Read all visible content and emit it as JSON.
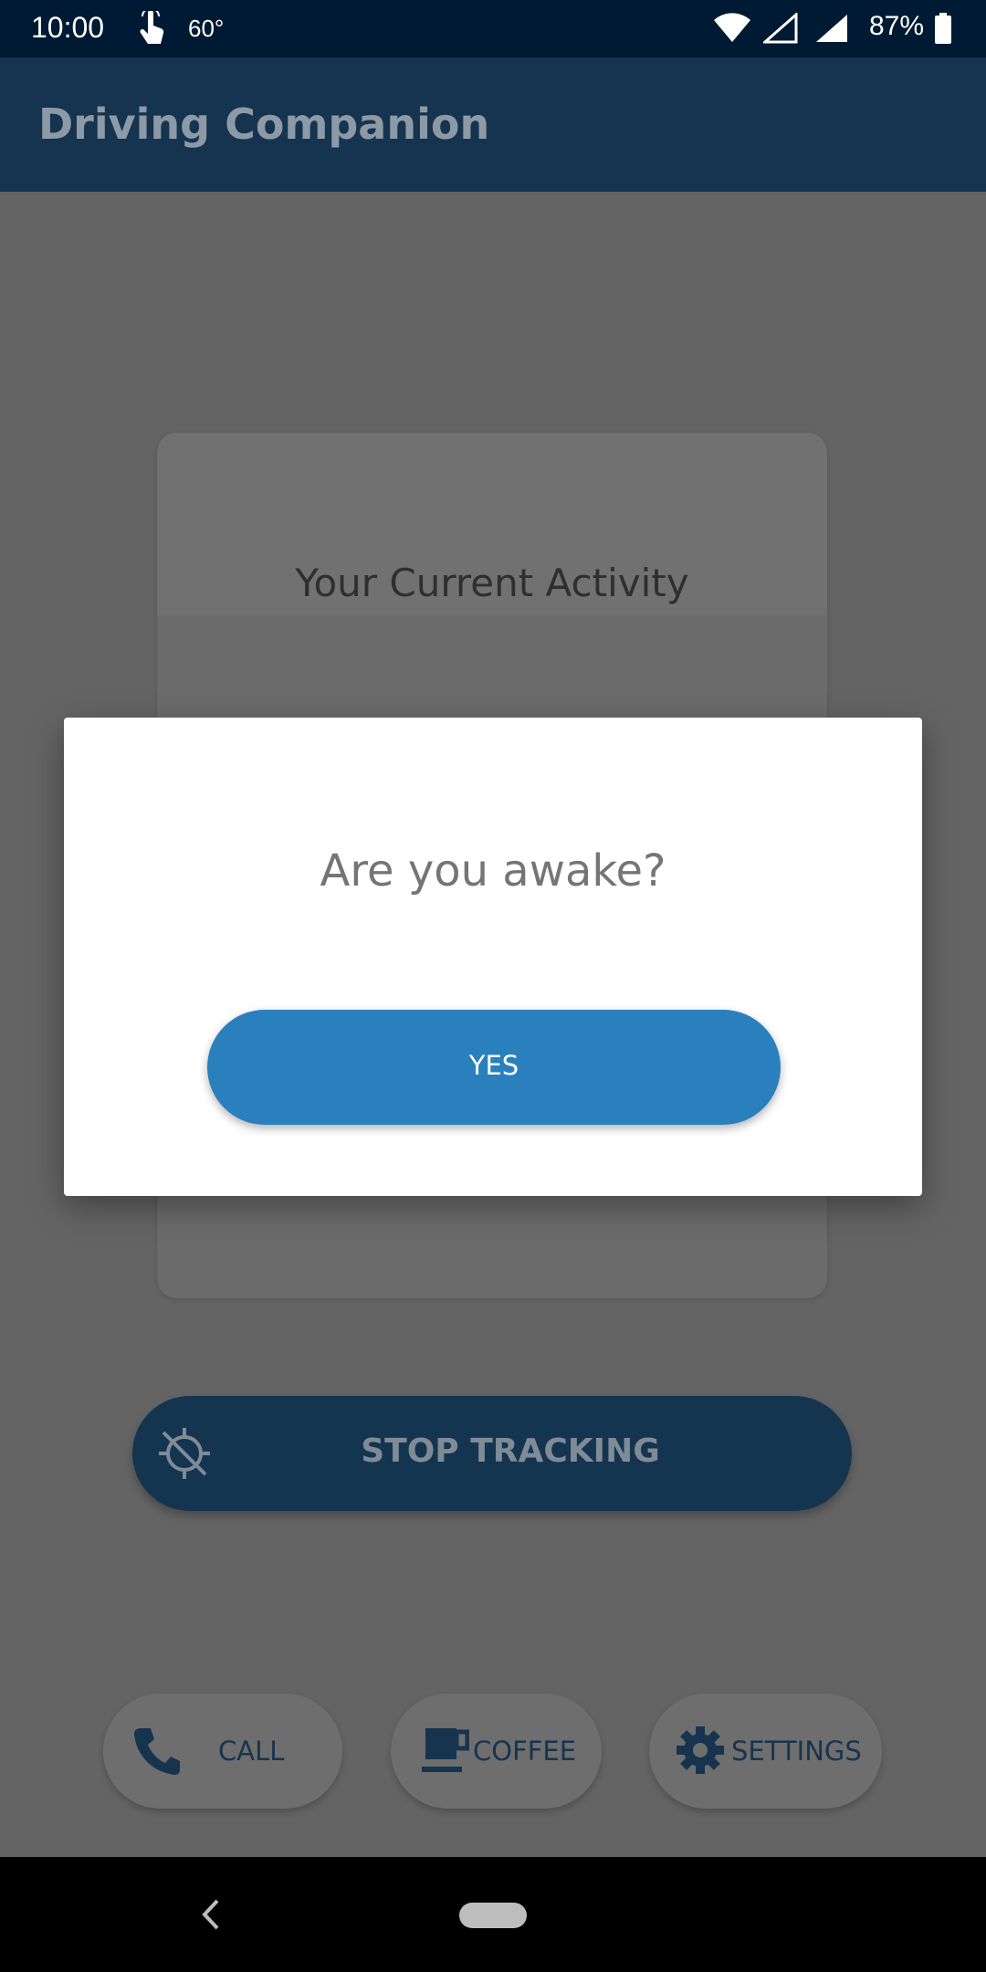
{
  "status_bar": {
    "time": "10:00",
    "temperature": "60°",
    "battery": "87%",
    "icons": [
      "touch-icon",
      "wifi-icon",
      "signal-icon",
      "signal-full-icon",
      "battery-icon"
    ]
  },
  "app_bar": {
    "title": "Driving Companion"
  },
  "activity_card": {
    "title": "Your Current Activity"
  },
  "stop_tracking": {
    "label": "STOP TRACKING",
    "icon": "gps-off-icon"
  },
  "quick_actions": [
    {
      "label": "CALL",
      "icon": "phone-icon"
    },
    {
      "label": "COFFEE",
      "icon": "coffee-cup-icon"
    },
    {
      "label": "SETTINGS",
      "icon": "gear-icon"
    }
  ],
  "dialog": {
    "question": "Are you awake?",
    "yes_label": "YES"
  },
  "nav_bar": {
    "icons": [
      "back-icon",
      "home-pill-icon"
    ]
  },
  "colors": {
    "status_bar": "#001a33",
    "app_bar": "#15344f",
    "accent": "#2a80bd",
    "scrim": "#646464",
    "dialog_text": "#757575"
  }
}
